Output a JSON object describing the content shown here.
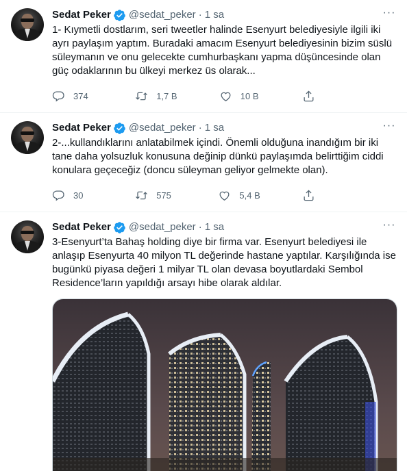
{
  "tweets": [
    {
      "name": "Sedat Peker",
      "handle": "@sedat_peker",
      "separator": "·",
      "time": "1 sa",
      "text": "1- Kıymetli dostlarım, seri tweetler halinde Esenyurt belediyesiyle ilgili iki ayrı paylaşım yaptım. Buradaki amacım Esenyurt belediyesinin bizim süslü süleymanın ve onu gelecekte cumhurbaşkanı yapma düşüncesinde olan güç odaklarının bu ülkeyi merkez üs olarak...",
      "replies": "374",
      "retweets": "1,7 B",
      "likes": "10 B"
    },
    {
      "name": "Sedat Peker",
      "handle": "@sedat_peker",
      "separator": "·",
      "time": "1 sa",
      "text": "2-...kullandıklarını anlatabilmek içindi. Önemli olduğuna inandığım bir iki tane daha yolsuzluk konusuna değinip dünkü paylaşımda belirttiğim ciddi konulara geçeceğiz (doncu süleyman geliyor gelmekte olan).",
      "replies": "30",
      "retweets": "575",
      "likes": "5,4 B"
    },
    {
      "name": "Sedat Peker",
      "handle": "@sedat_peker",
      "separator": "·",
      "time": "1 sa",
      "text": "3-Esenyurt’ta Bahaş holding diye bir firma var. Esenyurt belediyesi ile anlaşıp Esenyurta 40 milyon TL değerinde hastane yaptılar. Karşılığında ise bugünkü piyasa değeri 1 milyar TL olan devasa boyutlardaki Sembol Residence’ların yapıldığı arsayı hibe olarak aldılar."
    }
  ],
  "colors": {
    "verified": "#1d9bf0",
    "muted": "#536471",
    "text": "#0f1419",
    "divider": "#eff3f4"
  },
  "icons": [
    "more-icon",
    "verified-badge-icon",
    "reply-icon",
    "retweet-icon",
    "like-icon",
    "share-icon"
  ]
}
